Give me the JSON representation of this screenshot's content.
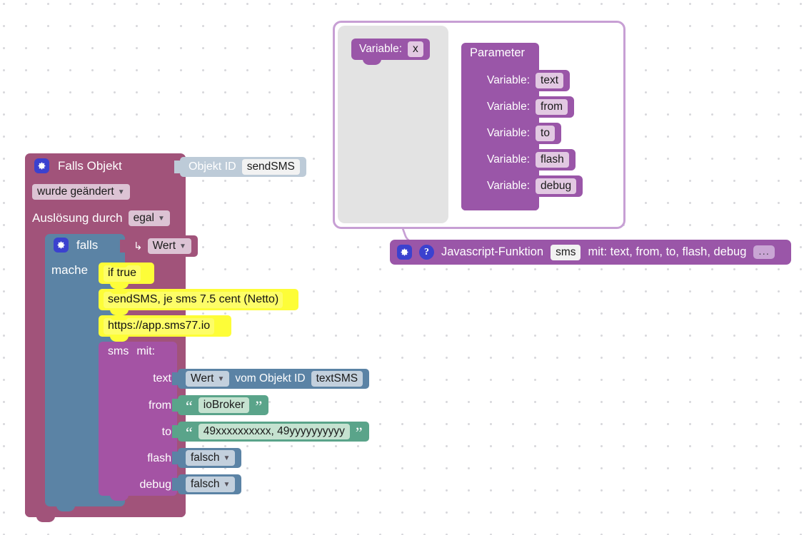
{
  "workspace": {
    "background": "#ffffff",
    "grid_dot_color": "#d8d8dc"
  },
  "trigger_block": {
    "gear_icon": "gear-icon",
    "title": "Falls Objekt",
    "object_id_label": "Objekt ID",
    "object_id_value": "sendSMS",
    "change_mode": "wurde geändert",
    "trigger_by_label": "Auslösung durch",
    "trigger_by_value": "egal",
    "color": "#a1537a"
  },
  "falls_block": {
    "gear_icon": "gear-icon",
    "title": "falls",
    "condition_arrow": "↳",
    "condition_value": "Wert",
    "do_label": "mache",
    "color": "#5b83a5"
  },
  "comments": [
    {
      "text": "if true"
    },
    {
      "text": "sendSMS, je sms 7.5 cent (Netto)"
    },
    {
      "text": "https://app.sms77.io"
    }
  ],
  "sms_call": {
    "name": "sms",
    "with_label": "mit:",
    "color": "#a453a4",
    "args": [
      {
        "label": "text",
        "kind": "getter",
        "getter_value": "Wert",
        "getter_mid": "vom Objekt ID",
        "getter_id": "textSMS"
      },
      {
        "label": "from",
        "kind": "string",
        "value": "ioBroker"
      },
      {
        "label": "to",
        "kind": "string",
        "value": "49xxxxxxxxxx, 49yyyyyyyyyy"
      },
      {
        "label": "flash",
        "kind": "boolean",
        "value": "falsch"
      },
      {
        "label": "debug",
        "kind": "boolean",
        "value": "falsch"
      }
    ]
  },
  "function_panel": {
    "border_color": "#c79fd4",
    "body_color": "#e3e3e3",
    "local_var": {
      "prefix": "Variable:",
      "name": "x"
    },
    "parameter_title": "Parameter",
    "parameters": [
      {
        "prefix": "Variable:",
        "name": "text"
      },
      {
        "prefix": "Variable:",
        "name": "from"
      },
      {
        "prefix": "Variable:",
        "name": "to"
      },
      {
        "prefix": "Variable:",
        "name": "flash"
      },
      {
        "prefix": "Variable:",
        "name": "debug"
      }
    ]
  },
  "js_function_bar": {
    "gear_icon": "gear-icon",
    "help_icon": "help-icon",
    "prefix": "Javascript-Funktion",
    "name": "sms",
    "suffix": "mit: text, from, to, flash, debug",
    "more_label": "...",
    "color": "#9a56a8"
  }
}
